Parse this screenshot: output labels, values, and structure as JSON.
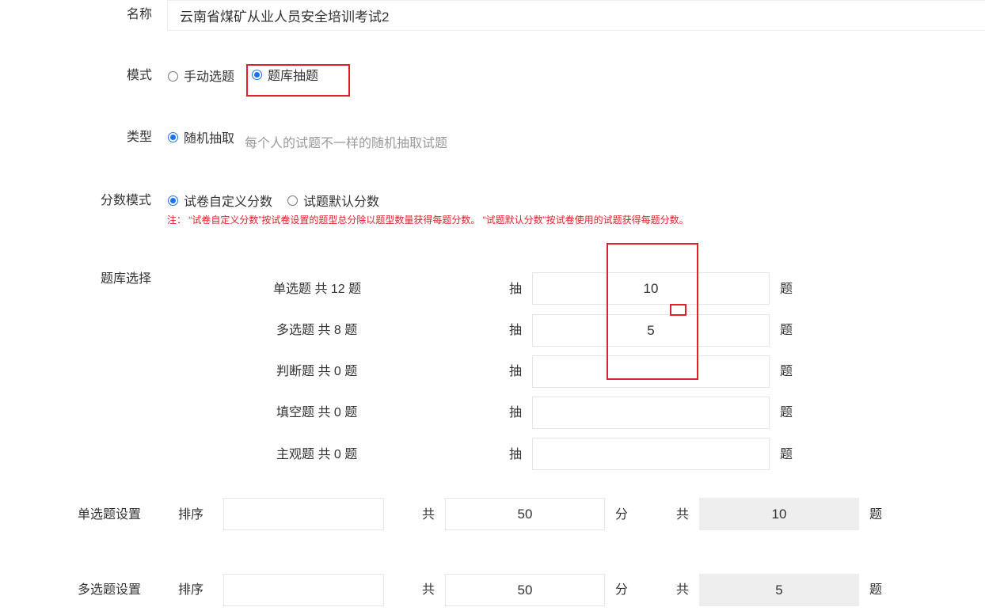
{
  "name": {
    "label": "名称",
    "value": "云南省煤矿从业人员安全培训考试2"
  },
  "mode": {
    "label": "模式",
    "option_manual": "手动选题",
    "option_bank": "题库抽题",
    "selected": "题库抽题"
  },
  "type": {
    "label": "类型",
    "option_random": "随机抽取",
    "hint": "每个人的试题不一样的随机抽取试题"
  },
  "score_mode": {
    "label": "分数模式",
    "option_custom": "试卷自定义分数",
    "option_default": "试题默认分数",
    "selected": "试卷自定义分数",
    "note": "注：  “试卷自定义分数”按试卷设置的题型总分除以题型数量获得每题分数。  “试题默认分数”按试卷使用的试题获得每题分数。"
  },
  "bank": {
    "label": "题库选择",
    "draw_label": "抽",
    "unit_label": "题",
    "rows": [
      {
        "name": "单选题 共 12 题",
        "value": "10"
      },
      {
        "name": "多选题 共 8 题",
        "value": "5"
      },
      {
        "name": "判断题 共 0 题",
        "value": ""
      },
      {
        "name": "填空题 共 0 题",
        "value": ""
      },
      {
        "name": "主观题 共 0 题",
        "value": ""
      }
    ]
  },
  "settings": [
    {
      "label": "单选题设置",
      "order_label": "排序",
      "order_value": "",
      "total_label": "共",
      "score": "50",
      "score_unit": "分",
      "count_label": "共",
      "count": "10",
      "count_unit": "题"
    },
    {
      "label": "多选题设置",
      "order_label": "排序",
      "order_value": "",
      "total_label": "共",
      "score": "50",
      "score_unit": "分",
      "count_label": "共",
      "count": "5",
      "count_unit": "题"
    }
  ],
  "colors": {
    "accent": "#1a73e8",
    "annotation_red": "#e0202b",
    "note_red": "#e0202b"
  }
}
